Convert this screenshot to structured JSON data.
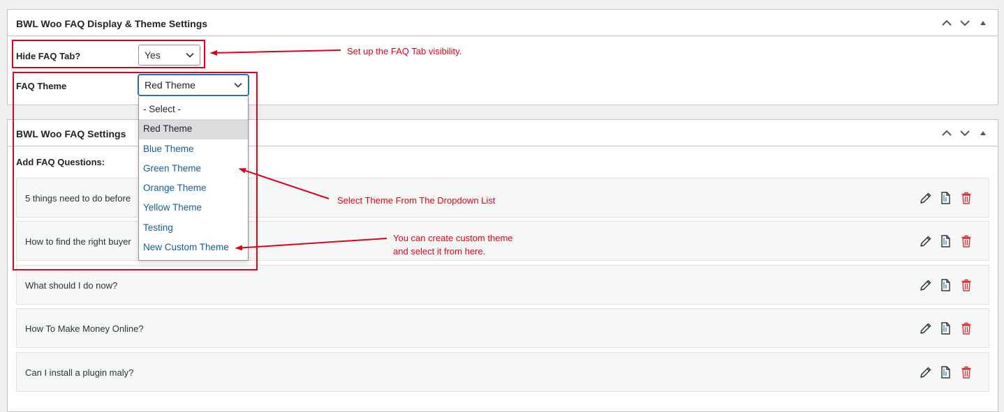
{
  "box1": {
    "title": "BWL Woo FAQ Display & Theme Settings",
    "hide_tab_label": "Hide FAQ Tab?",
    "hide_tab_value": "Yes",
    "theme_label": "FAQ Theme",
    "theme_value": "Red Theme"
  },
  "dropdown": {
    "options": [
      "- Select -",
      "Red Theme",
      "Blue Theme",
      "Green Theme",
      "Orange Theme",
      "Yellow Theme",
      "Testing",
      "New Custom Theme"
    ],
    "selected": "Red Theme"
  },
  "box2": {
    "title": "BWL Woo FAQ Settings",
    "add_label": "Add FAQ Questions:",
    "faqs": [
      "5 things need to do before",
      "How to find the right buyer",
      "What should I do now?",
      "How To Make Money Online?",
      "Can I install a plugin maly?"
    ]
  },
  "annotations": {
    "a1": "Set up the FAQ Tab visibility.",
    "a2": "Select Theme From The Dropdown List",
    "a3_line1": "You can create custom theme",
    "a3_line2": "and select it from here."
  },
  "colors": {
    "annotation_red": "#e0001b",
    "link_blue": "#135e96",
    "focus_blue": "#2271b1",
    "delete_red": "#d63638"
  },
  "icons": {
    "collapse_up": "chevron-up-icon",
    "collapse_down": "chevron-down-icon",
    "toggle": "triangle-up-icon",
    "edit": "pencil-icon",
    "duplicate": "copy-icon",
    "delete": "trash-icon"
  }
}
